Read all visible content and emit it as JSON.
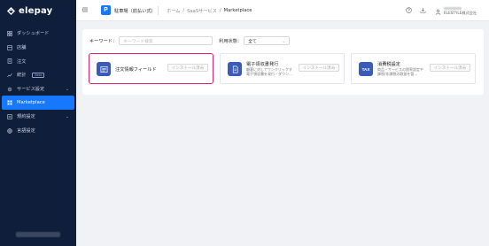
{
  "app": {
    "logo_text": "elepay"
  },
  "sidebar": {
    "items": [
      {
        "label": "ダッシュボード",
        "icon": "dashboard-icon"
      },
      {
        "label": "店舗",
        "icon": "store-icon"
      },
      {
        "label": "注文",
        "icon": "order-icon"
      },
      {
        "label": "統計",
        "icon": "chart-icon",
        "badge": "Beta"
      },
      {
        "label": "サービス設定",
        "icon": "gear-icon"
      },
      {
        "label": "Marketplace",
        "icon": "marketplace-icon",
        "active": true
      },
      {
        "label": "規約設定",
        "icon": "document-icon"
      },
      {
        "label": "言語設定",
        "icon": "language-icon"
      }
    ]
  },
  "header": {
    "store_badge": "P",
    "store_name": "駐車場（前払い式）",
    "breadcrumb": [
      "ホーム",
      "/",
      "SaaSサービス",
      "/",
      "Marketplace"
    ],
    "user_name": "ELESTYLE株式会社"
  },
  "filters": {
    "keyword_label": "キーワード：",
    "keyword_placeholder": "キーワード検索",
    "status_label": "利用状態：",
    "status_value": "全て"
  },
  "cards": [
    {
      "title": "注文情報フィールド",
      "desc1": "",
      "desc2": "",
      "icon_text": "",
      "button": "インストール済み"
    },
    {
      "title": "電子領収書発行",
      "desc1": "顧客に対してワンクリックす",
      "desc2": "電子領収書を発行・ダウン…",
      "icon_text": "",
      "button": "インストール済み"
    },
    {
      "title": "消費税設定",
      "desc1": "商品・サービスの税率設定や",
      "desc2": "課税/非課税の取扱を管…",
      "icon_text": "TAX",
      "button": "インストール済み"
    }
  ],
  "colors": {
    "sidebar_bg": "#0f1e3a",
    "accent": "#1677ff",
    "highlight": "#d6246e"
  }
}
